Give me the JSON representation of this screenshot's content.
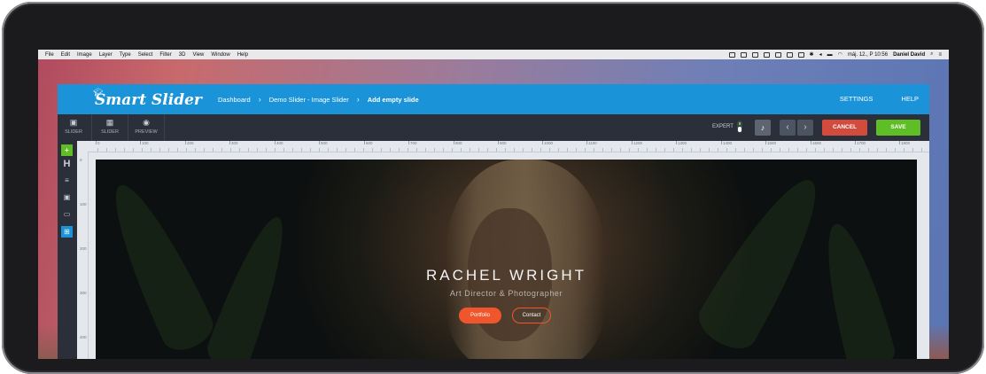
{
  "menubar": {
    "items": [
      "File",
      "Edit",
      "Image",
      "Layer",
      "Type",
      "Select",
      "Filter",
      "3D",
      "View",
      "Window",
      "Help"
    ],
    "datetime": "máj. 12., P 10:56",
    "user": "Daniel David"
  },
  "app": {
    "logo": "Smart Slider",
    "breadcrumbs": [
      "Dashboard",
      "Demo Slider - Image Slider",
      "Add empty slide"
    ],
    "settings": "SETTINGS",
    "help": "HELP",
    "tools": [
      {
        "label": "SLIDER",
        "icon": "image-icon"
      },
      {
        "label": "SLIDER",
        "icon": "grid-icon"
      },
      {
        "label": "PREVIEW",
        "icon": "eye-icon"
      }
    ],
    "expert": "EXPERT",
    "cancel": "CANCEL",
    "save": "SAVE",
    "sidebar_icons": [
      "add-icon",
      "heading-icon",
      "text-icon",
      "image-icon",
      "button-icon",
      "layout-icon"
    ]
  },
  "ruler": {
    "h_ticks": [
      "0",
      "100",
      "200",
      "300",
      "400",
      "500",
      "600",
      "700",
      "800",
      "900",
      "1000",
      "1100",
      "1200",
      "1300",
      "1400",
      "1500",
      "1600",
      "1700",
      "1800"
    ],
    "v_ticks": [
      "0",
      "100",
      "200",
      "300",
      "400"
    ]
  },
  "slide": {
    "heading": "RACHEL WRIGHT",
    "subheading": "Art Director & Photographer",
    "portfolio": "Portfolio",
    "contact": "Contact"
  },
  "colors": {
    "topbar": "#1b93d9",
    "cancel": "#d24b3c",
    "save": "#5fbe26",
    "accent": "#f0562b"
  }
}
